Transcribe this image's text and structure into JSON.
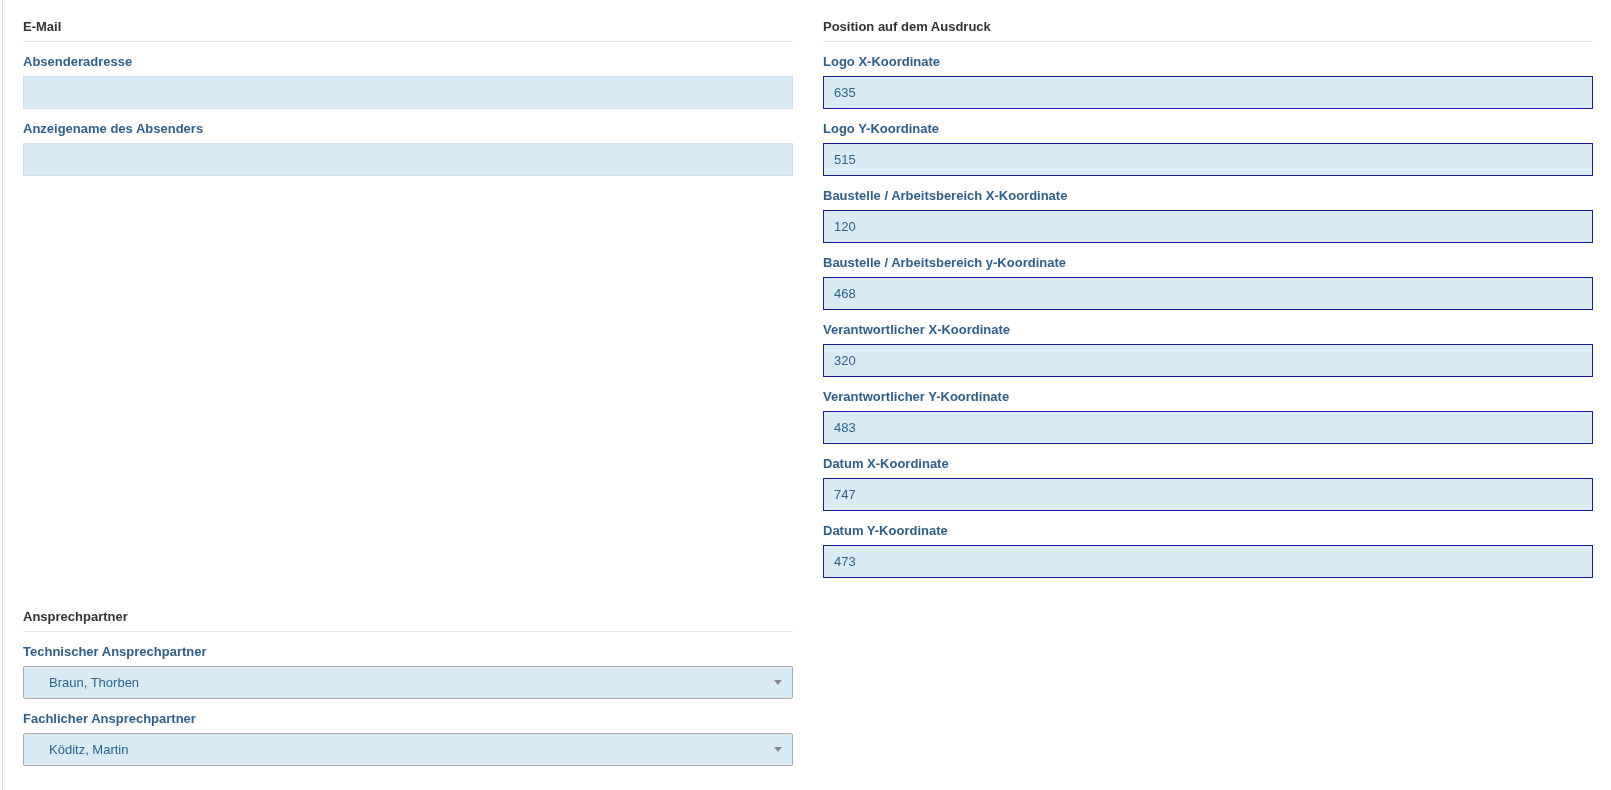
{
  "sections": [
    {
      "title": "E-Mail",
      "fields": [
        {
          "kind": "text",
          "label": "Absenderadresse",
          "outlined": false
        },
        {
          "kind": "text",
          "label": "Anzeigename des Absenders",
          "outlined": false
        }
      ]
    },
    {
      "title": "Position auf dem Ausdruck",
      "fields": [
        {
          "kind": "text",
          "label": "Logo X-Koordinate",
          "value": "635",
          "outlined": true
        },
        {
          "kind": "text",
          "label": "Logo Y-Koordinate",
          "value": "515",
          "outlined": true
        },
        {
          "kind": "text",
          "label": "Baustelle / Arbeitsbereich X-Koordinate",
          "value": "120",
          "outlined": true
        },
        {
          "kind": "text",
          "label": "Baustelle / Arbeitsbereich y-Koordinate",
          "value": "468",
          "outlined": true
        },
        {
          "kind": "text",
          "label": "Verantwortlicher X-Koordinate",
          "value": "320",
          "outlined": true
        },
        {
          "kind": "text",
          "label": "Verantwortlicher Y-Koordinate",
          "value": "483",
          "outlined": true
        },
        {
          "kind": "text",
          "label": "Datum X-Koordinate",
          "value": "747",
          "outlined": true
        },
        {
          "kind": "text",
          "label": "Datum Y-Koordinate",
          "value": "473",
          "outlined": true
        }
      ]
    },
    {
      "title": "Ansprechpartner",
      "fields": [
        {
          "kind": "select",
          "label": "Technischer Ansprechpartner",
          "value": "Braun, Thorben"
        },
        {
          "kind": "select",
          "label": "Fachlicher Ansprechpartner",
          "value": "Köditz, Martin"
        }
      ]
    }
  ]
}
